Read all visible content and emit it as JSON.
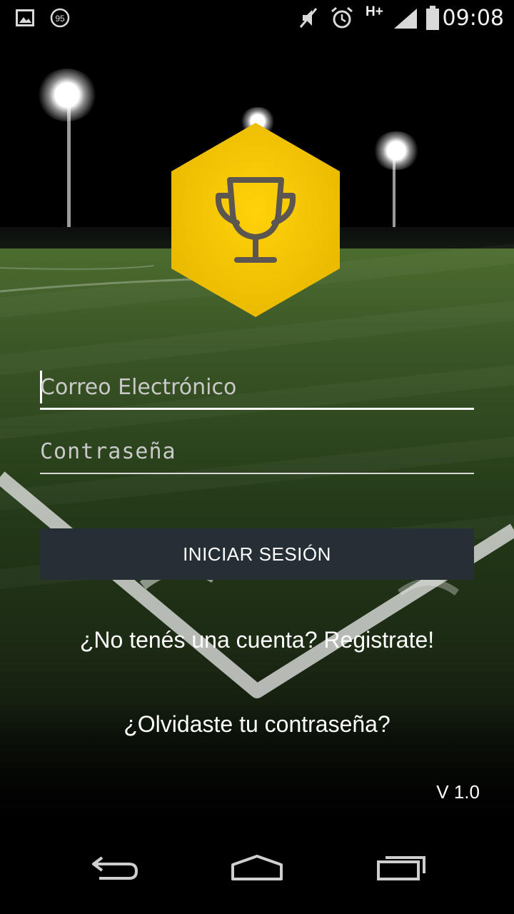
{
  "status_bar": {
    "time": "09:08",
    "network": "H+",
    "notification_badge": "95",
    "icons": [
      "gallery-notification-icon",
      "badge-95-icon",
      "mute-icon",
      "alarm-icon",
      "network-hplus-icon",
      "signal-icon",
      "battery-icon"
    ]
  },
  "logo": {
    "icon": "trophy-icon",
    "hex_color": "#f2c400",
    "icon_color": "#5b5650"
  },
  "form": {
    "email_placeholder": "Correo Electrónico",
    "password_placeholder": "Contraseña",
    "login_label": "INICIAR SESIÓN",
    "button_color": "#262f36"
  },
  "links": {
    "register": "¿No tenés una cuenta? Registrate!",
    "forgot": "¿Olvidaste tu contraseña?"
  },
  "version": "V 1.0",
  "nav_bar": {
    "icons": [
      "back-icon",
      "home-icon",
      "recents-icon"
    ]
  }
}
